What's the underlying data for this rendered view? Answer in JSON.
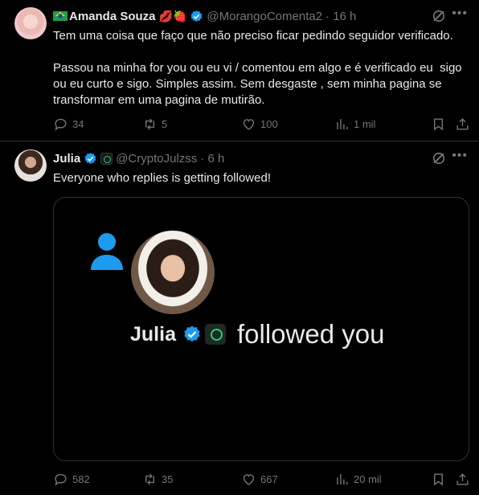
{
  "tweets": [
    {
      "author": "Amanda Souza",
      "emojis": "💋🍓",
      "handle": "@MorangoComenta2",
      "time": "· 16 h",
      "text": "Tem uma coisa que faço que não preciso ficar pedindo seguidor verificado.\n\nPassou na minha for you ou eu vi / comentou em algo e é verificado eu  sigo ou eu curto e sigo. Simples assim. Sem desgaste , sem minha pagina se transformar em uma pagina de mutirão.",
      "replies": "34",
      "reposts": "5",
      "likes": "100",
      "views": "1 mil"
    },
    {
      "author": "Julia",
      "handle": "@CryptoJulzss",
      "time": "· 6 h",
      "text": "Everyone who replies is getting followed!",
      "media": {
        "name": "Julia",
        "caption": "followed you"
      },
      "replies": "582",
      "reposts": "35",
      "likes": "667",
      "views": "20 mil"
    }
  ],
  "colors": {
    "background": "#000000",
    "text": "#e7e9ea",
    "muted": "#71767b",
    "verified": "#1d9bf0",
    "border": "#2f3336"
  },
  "icons": [
    "flag-brazil-icon",
    "verified-badge-icon",
    "grok-icon",
    "more-icon",
    "reply-icon",
    "repost-icon",
    "like-icon",
    "views-icon",
    "bookmark-icon",
    "share-icon",
    "user-silhouette-icon"
  ]
}
